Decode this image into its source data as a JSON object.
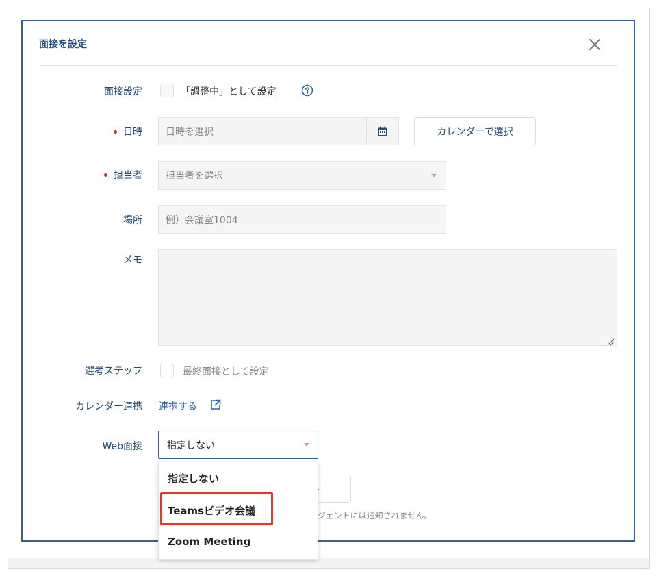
{
  "modal": {
    "title": "面接を設定",
    "close_icon": "close-icon"
  },
  "form": {
    "interview_setting": {
      "label": "面接設定",
      "checkbox_text": "「調整中」として設定",
      "help_icon": "question-circle-icon"
    },
    "datetime": {
      "label": "日時",
      "required": true,
      "placeholder": "日時を選択",
      "calendar_icon": "calendar-icon",
      "calendar_button": "カレンダーで選択"
    },
    "assignee": {
      "label": "担当者",
      "required": true,
      "placeholder": "担当者を選択"
    },
    "location": {
      "label": "場所",
      "placeholder": "例）会議室1004"
    },
    "memo": {
      "label": "メモ",
      "value": ""
    },
    "selection_step": {
      "label": "選考ステップ",
      "checkbox_text": "最終面接として設定"
    },
    "calendar_link": {
      "label": "カレンダー連携",
      "link_text": "連携する",
      "link_icon": "external-link-icon"
    },
    "web_interview": {
      "label": "Web面接",
      "selected": "指定しない",
      "options": [
        "指定しない",
        "Teamsビデオ会議",
        "Zoom Meeting"
      ]
    }
  },
  "footer": {
    "cancel_partial": "セル",
    "notice_partial": "ージェントには通知されません。"
  },
  "colors": {
    "accent": "#234a73",
    "link": "#2a63a6",
    "required": "#c0392b",
    "highlight": "#e03a30"
  }
}
